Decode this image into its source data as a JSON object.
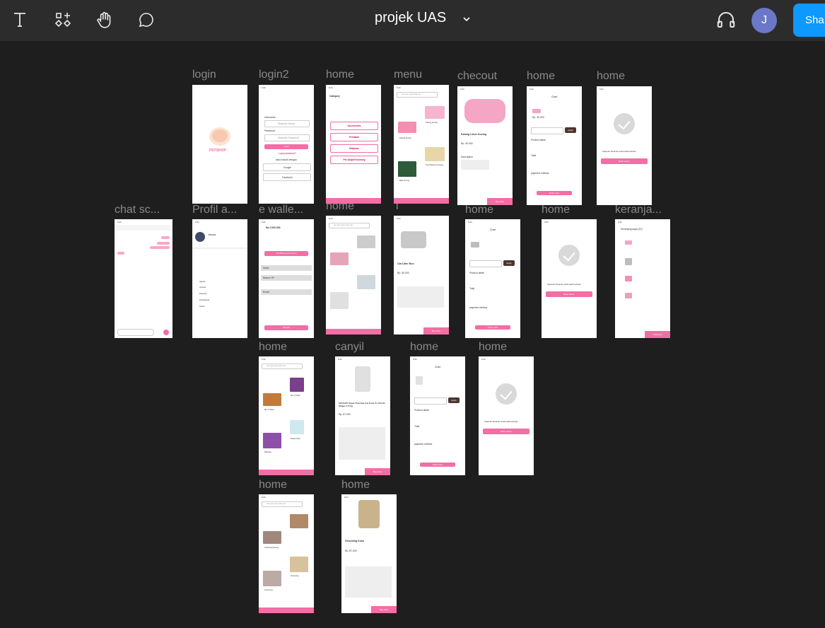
{
  "header": {
    "title": "projek UAS",
    "avatar_letter": "J",
    "share_label": "Sha",
    "tools": [
      "text-icon",
      "components-icon",
      "hand-icon",
      "comment-icon"
    ]
  },
  "frames": {
    "login": "login",
    "login2": "login2",
    "home1": "home",
    "menu": "menu",
    "checkout": "checout",
    "home2": "home",
    "home3": "home",
    "chat": "chat sc...",
    "profil": "Profil a...",
    "wallet": "e walle...",
    "home4": "home",
    "i": "i",
    "home5": "home",
    "home6": "home",
    "keranjang": "keranja...",
    "home7": "home",
    "canyil": "canyil",
    "home8": "home",
    "home9": "home",
    "home10": "home",
    "home11": "home"
  },
  "content": {
    "brand": "PETSHOP",
    "status_time": "9:41",
    "login2_username_label": "Username",
    "login2_username_ph": "Masukan Nama",
    "login2_password_label": "Password",
    "login2_password_ph": "Masukan Password",
    "login2_login_btn": "Login",
    "login2_forgot": "Lupa password?",
    "login2_or": "atau masuk dengan",
    "login2_google": "Google",
    "login2_facebook": "Facebook",
    "category_title": "Category",
    "categories": [
      "Accessories",
      "Peralatan",
      "Makanan",
      "Pet Adopt/Grooming"
    ],
    "search_ph": "cari apa yang anda cari",
    "menu_items": [
      "Kalung Kucing",
      "Kalung Kucing",
      "Kalung Kucing",
      "Topi Pokemon Kucing",
      "Baju Kucing"
    ],
    "checkout_product": "Kalung Leher Kucing",
    "checkout_price": "Rp. 40.000",
    "checkout_desc_title": "Description",
    "checkout_buy": "Buy Now",
    "chart_title": "Chart",
    "chart_price": "Rp. 40.000",
    "apply_btn": "Apply",
    "order_btn": "Order Now",
    "product_detail": "Product detail",
    "total_label": "Total",
    "payment_method": "payment method",
    "success_msg": "Selamat! Pesanan anda telah berhasil",
    "back_home": "Back Home",
    "wallet_balance": "Rp 2.000.000",
    "wallet_verify": "Verifikasi ke Premium",
    "wallet_rows": [
      "Saldo",
      "Nomor HP",
      "Email"
    ],
    "wallet_save": "Simpan",
    "profile_name": "Jessica",
    "profile_items": [
      "Alamat",
      "Voucher",
      "Pesanan",
      "Pembayaran",
      "Keluar"
    ],
    "litter_product": "Cat Litter Box",
    "litter_price": "Rp. 50.000",
    "keranjang_title": "Keranjang saya (10)",
    "keranjang_checkout": "Checkout",
    "food_items": [
      "Me-O Kitten",
      "Me-O Kitten",
      "Whiskas",
      "Royal Canin"
    ],
    "canyil_product": "COUCOU Super Premium Cat Food for All Life Stages 1.5 Kg",
    "canyil_price": "Rp. 87.000",
    "grooming_items": [
      "Grooming Kucing",
      "Grooming Kucing",
      "Grooming",
      "Grooming"
    ],
    "grooming_product": "Grooming Kuku",
    "grooming_price": "Rp. 87.000"
  },
  "colors": {
    "accent_pink": "#f26ea4",
    "figma_blue": "#0d99ff",
    "avatar_purple": "#6b78c9",
    "canvas": "#1e1e1e",
    "toolbar": "#2c2c2c"
  }
}
